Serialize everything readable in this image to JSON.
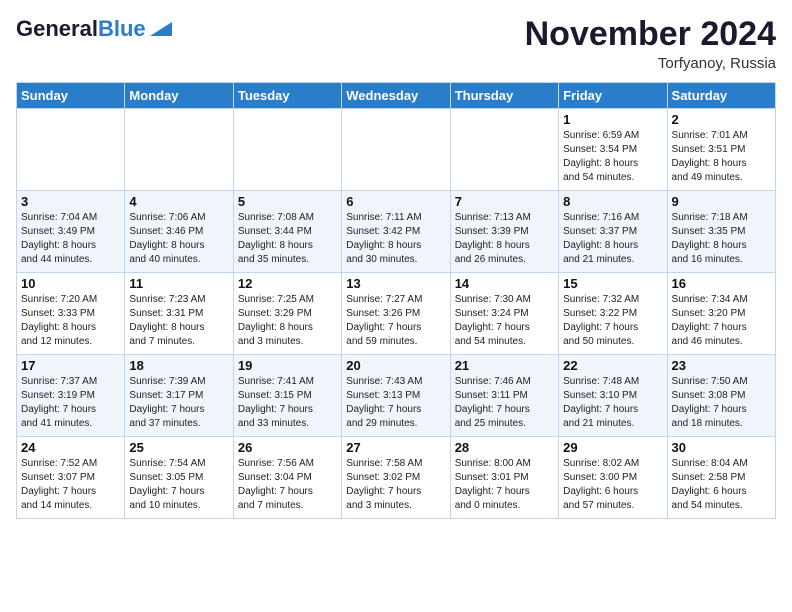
{
  "logo": {
    "line1": "General",
    "line2": "Blue",
    "tagline": "GeneralBlue"
  },
  "header": {
    "month": "November 2024",
    "location": "Torfyanoy, Russia"
  },
  "days_of_week": [
    "Sunday",
    "Monday",
    "Tuesday",
    "Wednesday",
    "Thursday",
    "Friday",
    "Saturday"
  ],
  "weeks": [
    [
      {
        "day": "",
        "info": ""
      },
      {
        "day": "",
        "info": ""
      },
      {
        "day": "",
        "info": ""
      },
      {
        "day": "",
        "info": ""
      },
      {
        "day": "",
        "info": ""
      },
      {
        "day": "1",
        "info": "Sunrise: 6:59 AM\nSunset: 3:54 PM\nDaylight: 8 hours\nand 54 minutes."
      },
      {
        "day": "2",
        "info": "Sunrise: 7:01 AM\nSunset: 3:51 PM\nDaylight: 8 hours\nand 49 minutes."
      }
    ],
    [
      {
        "day": "3",
        "info": "Sunrise: 7:04 AM\nSunset: 3:49 PM\nDaylight: 8 hours\nand 44 minutes."
      },
      {
        "day": "4",
        "info": "Sunrise: 7:06 AM\nSunset: 3:46 PM\nDaylight: 8 hours\nand 40 minutes."
      },
      {
        "day": "5",
        "info": "Sunrise: 7:08 AM\nSunset: 3:44 PM\nDaylight: 8 hours\nand 35 minutes."
      },
      {
        "day": "6",
        "info": "Sunrise: 7:11 AM\nSunset: 3:42 PM\nDaylight: 8 hours\nand 30 minutes."
      },
      {
        "day": "7",
        "info": "Sunrise: 7:13 AM\nSunset: 3:39 PM\nDaylight: 8 hours\nand 26 minutes."
      },
      {
        "day": "8",
        "info": "Sunrise: 7:16 AM\nSunset: 3:37 PM\nDaylight: 8 hours\nand 21 minutes."
      },
      {
        "day": "9",
        "info": "Sunrise: 7:18 AM\nSunset: 3:35 PM\nDaylight: 8 hours\nand 16 minutes."
      }
    ],
    [
      {
        "day": "10",
        "info": "Sunrise: 7:20 AM\nSunset: 3:33 PM\nDaylight: 8 hours\nand 12 minutes."
      },
      {
        "day": "11",
        "info": "Sunrise: 7:23 AM\nSunset: 3:31 PM\nDaylight: 8 hours\nand 7 minutes."
      },
      {
        "day": "12",
        "info": "Sunrise: 7:25 AM\nSunset: 3:29 PM\nDaylight: 8 hours\nand 3 minutes."
      },
      {
        "day": "13",
        "info": "Sunrise: 7:27 AM\nSunset: 3:26 PM\nDaylight: 7 hours\nand 59 minutes."
      },
      {
        "day": "14",
        "info": "Sunrise: 7:30 AM\nSunset: 3:24 PM\nDaylight: 7 hours\nand 54 minutes."
      },
      {
        "day": "15",
        "info": "Sunrise: 7:32 AM\nSunset: 3:22 PM\nDaylight: 7 hours\nand 50 minutes."
      },
      {
        "day": "16",
        "info": "Sunrise: 7:34 AM\nSunset: 3:20 PM\nDaylight: 7 hours\nand 46 minutes."
      }
    ],
    [
      {
        "day": "17",
        "info": "Sunrise: 7:37 AM\nSunset: 3:19 PM\nDaylight: 7 hours\nand 41 minutes."
      },
      {
        "day": "18",
        "info": "Sunrise: 7:39 AM\nSunset: 3:17 PM\nDaylight: 7 hours\nand 37 minutes."
      },
      {
        "day": "19",
        "info": "Sunrise: 7:41 AM\nSunset: 3:15 PM\nDaylight: 7 hours\nand 33 minutes."
      },
      {
        "day": "20",
        "info": "Sunrise: 7:43 AM\nSunset: 3:13 PM\nDaylight: 7 hours\nand 29 minutes."
      },
      {
        "day": "21",
        "info": "Sunrise: 7:46 AM\nSunset: 3:11 PM\nDaylight: 7 hours\nand 25 minutes."
      },
      {
        "day": "22",
        "info": "Sunrise: 7:48 AM\nSunset: 3:10 PM\nDaylight: 7 hours\nand 21 minutes."
      },
      {
        "day": "23",
        "info": "Sunrise: 7:50 AM\nSunset: 3:08 PM\nDaylight: 7 hours\nand 18 minutes."
      }
    ],
    [
      {
        "day": "24",
        "info": "Sunrise: 7:52 AM\nSunset: 3:07 PM\nDaylight: 7 hours\nand 14 minutes."
      },
      {
        "day": "25",
        "info": "Sunrise: 7:54 AM\nSunset: 3:05 PM\nDaylight: 7 hours\nand 10 minutes."
      },
      {
        "day": "26",
        "info": "Sunrise: 7:56 AM\nSunset: 3:04 PM\nDaylight: 7 hours\nand 7 minutes."
      },
      {
        "day": "27",
        "info": "Sunrise: 7:58 AM\nSunset: 3:02 PM\nDaylight: 7 hours\nand 3 minutes."
      },
      {
        "day": "28",
        "info": "Sunrise: 8:00 AM\nSunset: 3:01 PM\nDaylight: 7 hours\nand 0 minutes."
      },
      {
        "day": "29",
        "info": "Sunrise: 8:02 AM\nSunset: 3:00 PM\nDaylight: 6 hours\nand 57 minutes."
      },
      {
        "day": "30",
        "info": "Sunrise: 8:04 AM\nSunset: 2:58 PM\nDaylight: 6 hours\nand 54 minutes."
      }
    ]
  ]
}
